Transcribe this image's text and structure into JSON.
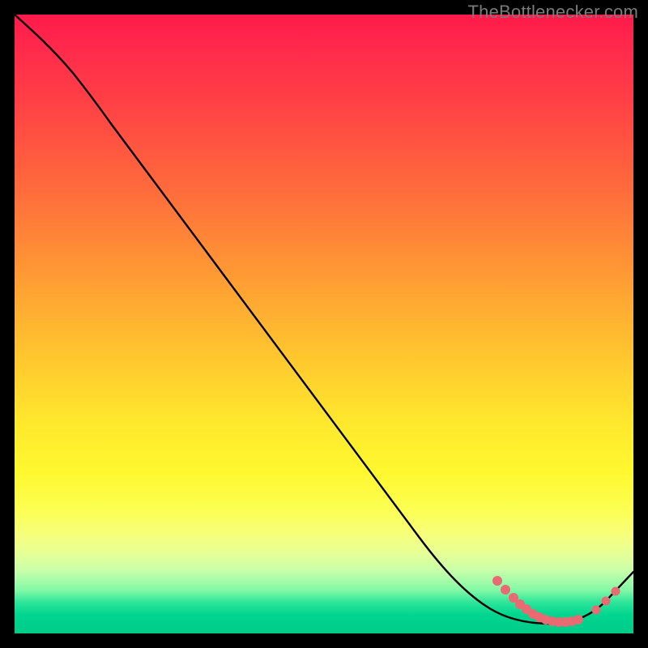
{
  "watermark": "TheBottlenecker.com",
  "colors": {
    "frame": "#000000",
    "curve": "#000000",
    "marker": "#e96a72",
    "watermark": "#7a7a7a"
  },
  "chart_data": {
    "type": "line",
    "title": "",
    "xlabel": "",
    "ylabel": "",
    "xlim": [
      0,
      100
    ],
    "ylim": [
      0,
      100
    ],
    "grid": false,
    "legend": false,
    "series": [
      {
        "name": "bottleneck-curve",
        "x": [
          0,
          4,
          8,
          12,
          20,
          30,
          40,
          50,
          60,
          67,
          72,
          76,
          80,
          84,
          88,
          92,
          96,
          100
        ],
        "y": [
          100,
          97,
          94,
          90,
          81,
          70,
          59,
          47,
          36,
          27,
          20,
          13,
          6,
          3,
          2,
          2,
          5,
          10
        ]
      }
    ],
    "marker_points": {
      "name": "highlighted-range",
      "x": [
        78,
        79.5,
        81,
        82,
        83,
        84,
        85,
        86,
        87,
        88,
        89,
        90,
        91.5,
        94,
        95.5,
        97
      ],
      "y": [
        8.5,
        7.2,
        6.0,
        5.2,
        4.5,
        3.8,
        3.2,
        2.8,
        2.5,
        2.2,
        2.1,
        2.0,
        2.0,
        3.2,
        4.3,
        5.5
      ]
    }
  }
}
